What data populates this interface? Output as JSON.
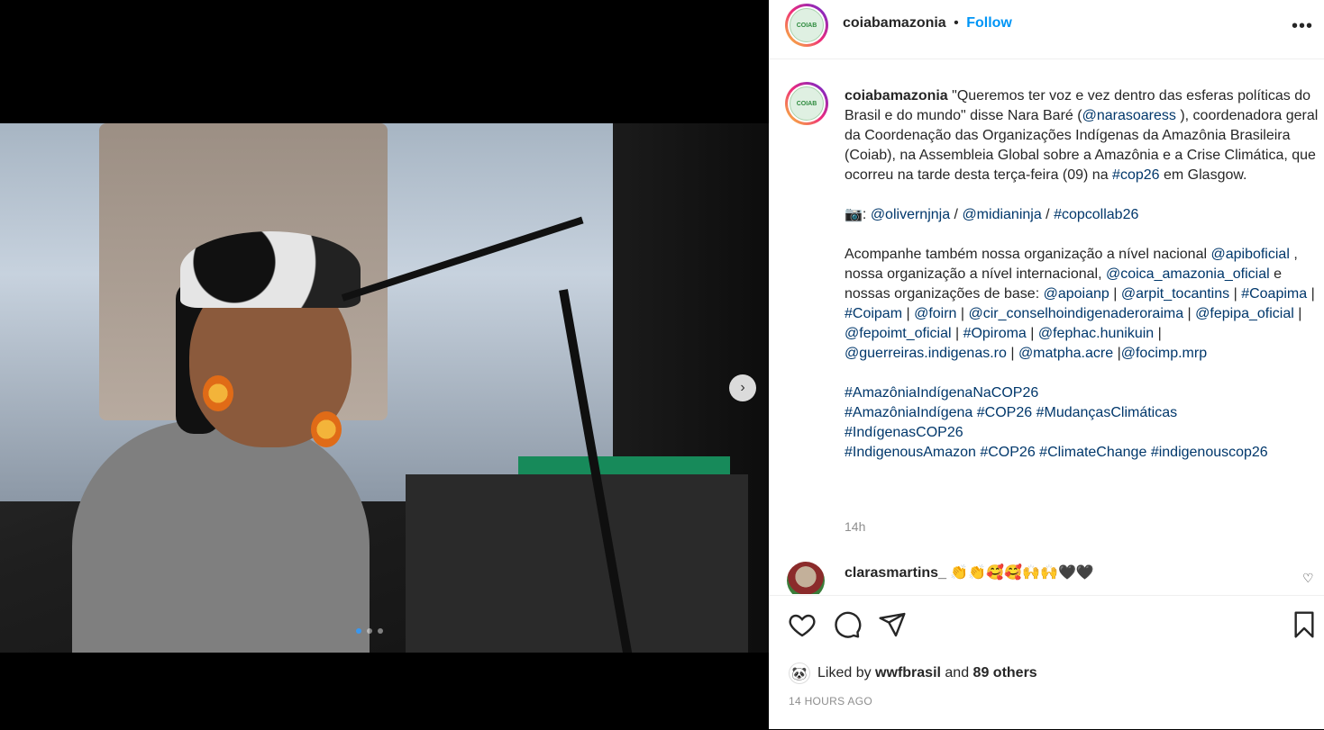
{
  "post": {
    "username": "coiabamazonia",
    "separator": "•",
    "follow_label": "Follow",
    "more_label": "•••",
    "avatar_text": "COIAB",
    "next_label": "›"
  },
  "caption": {
    "username": "coiabamazonia",
    "p1_a": " \"Queremos ter voz e vez dentro das esferas políticas do Brasil e do mundo\" disse Nara Baré (",
    "p1_mention": "@narasoaress",
    "p1_b": " ), coordenadora geral da Coordenação das Organizações Indígenas da Amazônia Brasileira (Coiab), na Assembleia Global sobre a Amazônia e a Crise Climática, que ocorreu na tarde desta terça-feira (09) na ",
    "p1_tag": "#cop26",
    "p1_c": " em Glasgow.",
    "p2_camera": "📷: ",
    "p2_m1": "@olivernjnja",
    "p2_sep1": " / ",
    "p2_m2": "@midianinja",
    "p2_sep2": " / ",
    "p2_m3": "#copcollab26",
    "p3_a": "Acompanhe também nossa organização a nível nacional ",
    "p3_m1": "@apiboficial",
    "p3_b": " , nossa organização a nível internacional, ",
    "p3_m2": "@coica_amazonia_oficial",
    "p3_c": " e nossas organizações de base: ",
    "p3_m3": "@apoianp",
    "p3_d": " | ",
    "p3_m4": "@arpit_tocantins",
    "p3_e": " | ",
    "p3_m5": "#Coapima",
    "p3_f": " | ",
    "p3_m6": "#Coipam",
    "p3_g": " | ",
    "p3_m7": "@foirn",
    "p3_h": " | ",
    "p3_m8": "@cir_conselhoindigenaderoraima",
    "p3_i": " | ",
    "p3_m9": "@fepipa_oficial",
    "p3_j": " | ",
    "p3_m10": "@fepoimt_oficial",
    "p3_k": " | ",
    "p3_m11": "#Opiroma",
    "p3_l": " | ",
    "p3_m12": "@fephac.hunikuin",
    "p3_m": " | ",
    "p3_m13": "@guerreiras.indigenas.ro",
    "p3_n": " | ",
    "p3_m14": "@matpha.acre",
    "p3_o": " |",
    "p3_m15": "@focimp.mrp",
    "h1": "#AmazôniaIndígenaNaCOP26",
    "h2": "#AmazôniaIndígena",
    "h3": "#COP26",
    "h4": "#MudançasClimáticas",
    "h5": "#IndígenasCOP26",
    "h6": "#IndigenousAmazon",
    "h7": "#COP26",
    "h8": "#ClimateChange",
    "h9": "#indigenouscop26",
    "time": "14h"
  },
  "comment": {
    "username": "clarasmartins_",
    "text": " 👏👏🥰🥰🙌🙌🖤🖤",
    "heart": "♡"
  },
  "likes": {
    "prefix": "Liked by ",
    "user": "wwfbrasil",
    "middle": " and ",
    "count": "89 others",
    "avatar_icon": "🐼"
  },
  "timestamp": "14 HOURS AGO",
  "carousel": {
    "total": 3,
    "active": 0
  }
}
